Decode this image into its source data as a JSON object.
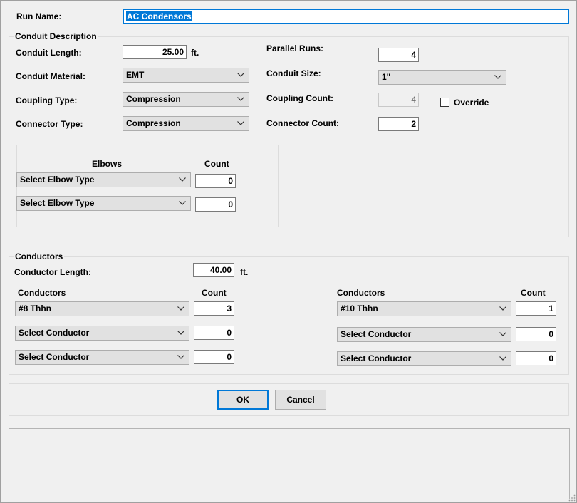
{
  "run_name": {
    "label": "Run Name:",
    "value": "AC Condensors"
  },
  "conduit": {
    "group_title": "Conduit Description",
    "length_label": "Conduit Length:",
    "length_value": "25.00",
    "length_unit": "ft.",
    "material_label": "Conduit Material:",
    "material_value": "EMT",
    "coupling_type_label": "Coupling Type:",
    "coupling_type_value": "Compression",
    "connector_type_label": "Connector Type:",
    "connector_type_value": "Compression",
    "parallel_runs_label": "Parallel Runs:",
    "parallel_runs_value": "4",
    "size_label": "Conduit Size:",
    "size_value": "1\"",
    "coupling_count_label": "Coupling Count:",
    "coupling_count_value": "4",
    "override_label": "Override",
    "connector_count_label": "Connector Count:",
    "connector_count_value": "2"
  },
  "elbows": {
    "header": "Elbows",
    "count_header": "Count",
    "rows": [
      {
        "type": "Select Elbow Type",
        "count": "0"
      },
      {
        "type": "Select Elbow Type",
        "count": "0"
      }
    ]
  },
  "conductors": {
    "group_title": "Conductors",
    "length_label": "Conductor Length:",
    "length_value": "40.00",
    "length_unit": "ft.",
    "left": {
      "header": "Conductors",
      "count_header": "Count",
      "rows": [
        {
          "type": "#8 Thhn",
          "count": "3"
        },
        {
          "type": "Select Conductor",
          "count": "0"
        },
        {
          "type": "Select Conductor",
          "count": "0"
        }
      ]
    },
    "right": {
      "header": "Conductors",
      "count_header": "Count",
      "rows": [
        {
          "type": "#10 Thhn",
          "count": "1"
        },
        {
          "type": "Select Conductor",
          "count": "0"
        },
        {
          "type": "Select Conductor",
          "count": "0"
        }
      ]
    }
  },
  "buttons": {
    "ok": "OK",
    "cancel": "Cancel"
  },
  "icons": {
    "dropdown": "chevron-down-icon",
    "grip": "resize-grip-icon"
  },
  "colors": {
    "accent": "#0078d7",
    "background": "#f0f0f0",
    "control": "#e1e1e1"
  }
}
